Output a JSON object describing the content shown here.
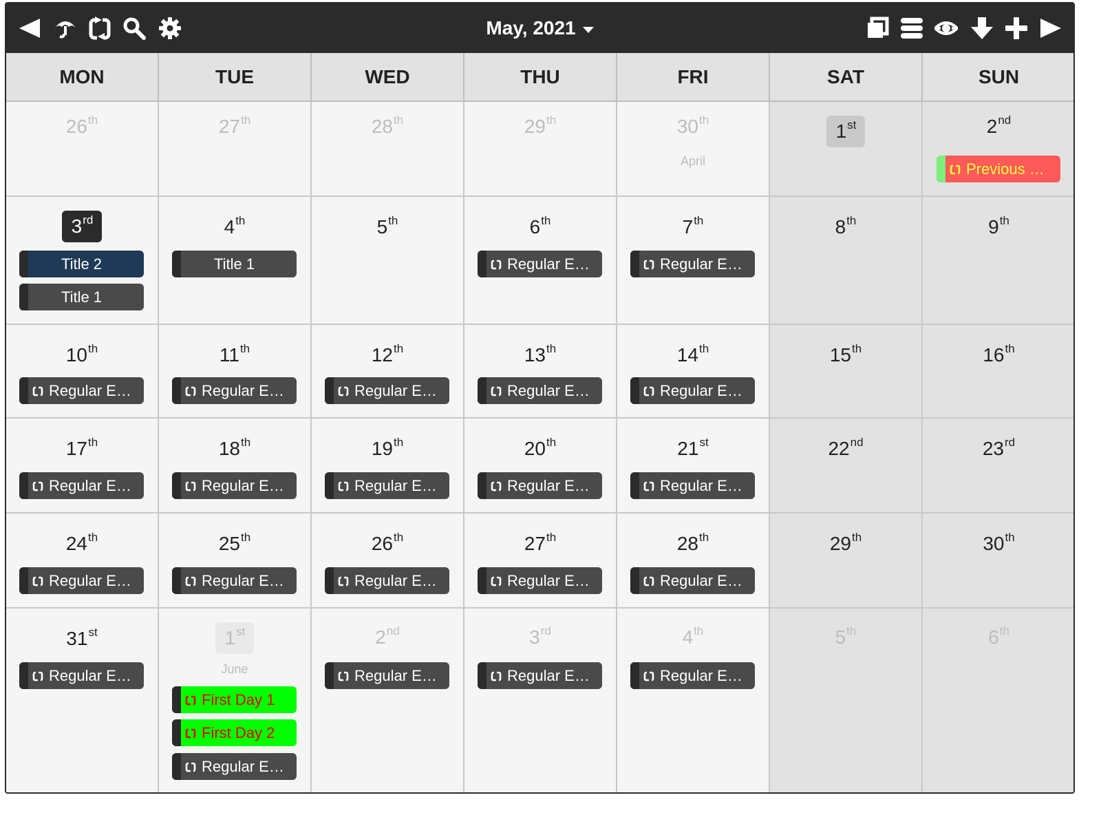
{
  "toolbar": {
    "title": "May, 2021",
    "left_icons": [
      "previous-icon",
      "umbrella-icon",
      "recurring-icon",
      "search-icon",
      "settings-icon"
    ],
    "right_icons": [
      "view-window-icon",
      "list-view-icon",
      "visibility-eye-icon",
      "download-icon",
      "add-icon",
      "next-icon"
    ]
  },
  "weekdays": [
    "MON",
    "TUE",
    "WED",
    "THU",
    "FRI",
    "SAT",
    "SUN"
  ],
  "days": {
    "w1": [
      {
        "n": "26",
        "s": "th"
      },
      {
        "n": "27",
        "s": "th"
      },
      {
        "n": "28",
        "s": "th"
      },
      {
        "n": "29",
        "s": "th"
      },
      {
        "n": "30",
        "s": "th",
        "sub": "April"
      },
      {
        "n": "1",
        "s": "st"
      },
      {
        "n": "2",
        "s": "nd"
      }
    ],
    "w2": [
      {
        "n": "3",
        "s": "rd"
      },
      {
        "n": "4",
        "s": "th"
      },
      {
        "n": "5",
        "s": "th"
      },
      {
        "n": "6",
        "s": "th"
      },
      {
        "n": "7",
        "s": "th"
      },
      {
        "n": "8",
        "s": "th"
      },
      {
        "n": "9",
        "s": "th"
      }
    ],
    "w3": [
      {
        "n": "10",
        "s": "th"
      },
      {
        "n": "11",
        "s": "th"
      },
      {
        "n": "12",
        "s": "th"
      },
      {
        "n": "13",
        "s": "th"
      },
      {
        "n": "14",
        "s": "th"
      },
      {
        "n": "15",
        "s": "th"
      },
      {
        "n": "16",
        "s": "th"
      }
    ],
    "w4": [
      {
        "n": "17",
        "s": "th"
      },
      {
        "n": "18",
        "s": "th"
      },
      {
        "n": "19",
        "s": "th"
      },
      {
        "n": "20",
        "s": "th"
      },
      {
        "n": "21",
        "s": "st"
      },
      {
        "n": "22",
        "s": "nd"
      },
      {
        "n": "23",
        "s": "rd"
      }
    ],
    "w5": [
      {
        "n": "24",
        "s": "th"
      },
      {
        "n": "25",
        "s": "th"
      },
      {
        "n": "26",
        "s": "th"
      },
      {
        "n": "27",
        "s": "th"
      },
      {
        "n": "28",
        "s": "th"
      },
      {
        "n": "29",
        "s": "th"
      },
      {
        "n": "30",
        "s": "th"
      }
    ],
    "w6": [
      {
        "n": "31",
        "s": "st"
      },
      {
        "n": "1",
        "s": "st",
        "sub": "June"
      },
      {
        "n": "2",
        "s": "nd"
      },
      {
        "n": "3",
        "s": "rd"
      },
      {
        "n": "4",
        "s": "th"
      },
      {
        "n": "5",
        "s": "th"
      },
      {
        "n": "6",
        "s": "th"
      }
    ]
  },
  "events": {
    "previous_day": "Previous Day",
    "title_2": "Title 2",
    "title_1": "Title 1",
    "regular": "Regular Ev…",
    "first_day_1": "First Day 1",
    "first_day_2": "First Day 2"
  },
  "colors": {
    "toolbar": "#2b2b2b",
    "weekend": "#e2e2e2",
    "event_default": "#4a4a4a",
    "event_navy": "#1f3a57",
    "event_green": "#00ff00",
    "event_red": "#ff5a5a"
  }
}
